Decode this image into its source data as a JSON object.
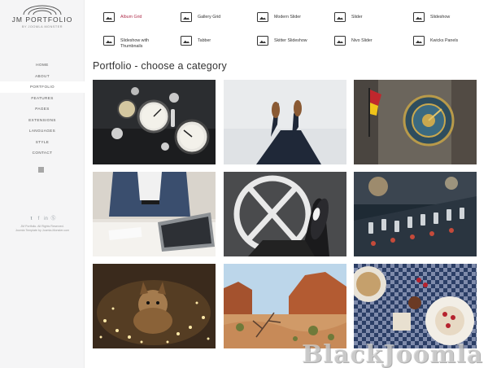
{
  "sidebar": {
    "logo_title": "JM PORTFOLIO",
    "logo_subtitle": "BY JOOMLA MONSTER",
    "menu": [
      "HOME",
      "ABOUT",
      "PORTFOLIO",
      "FEATURES",
      "PAGES",
      "EXTENSIONS",
      "LANGUAGES",
      "STYLE",
      "CONTACT"
    ],
    "active_item": "PORTFOLIO",
    "social_icons": [
      "twitter-icon",
      "facebook-icon",
      "linkedin-icon",
      "skype-icon"
    ],
    "copyright_line1": "JM Portfolio. All Rights Reserved.",
    "copyright_line2": "Joomla Template by Joomla-Monster.com"
  },
  "categories": [
    {
      "label": "Album Grid",
      "active": true,
      "icon": "album-grid-icon"
    },
    {
      "label": "Gallery Grid",
      "active": false,
      "icon": "gallery-grid-icon"
    },
    {
      "label": "Modern Slider",
      "active": false,
      "icon": "modern-slider-icon"
    },
    {
      "label": "Slider",
      "active": false,
      "icon": "slider-icon"
    },
    {
      "label": "Slideshow",
      "active": false,
      "icon": "slideshow-icon"
    },
    {
      "label": "Slideshow with Thumbnails",
      "active": false,
      "icon": "slideshow-thumbnails-icon"
    },
    {
      "label": "Tabber",
      "active": false,
      "icon": "tabber-icon"
    },
    {
      "label": "Skitter Slideshow",
      "active": false,
      "icon": "skitter-slideshow-icon"
    },
    {
      "label": "Nivo Slider",
      "active": false,
      "icon": "nivo-slider-icon"
    },
    {
      "label": "Kwicks Panels",
      "active": false,
      "icon": "kwicks-panels-icon"
    }
  ],
  "heading": "Portfolio - choose a category",
  "gallery": [
    "car-dashboard-gauges",
    "feet-on-snow",
    "astronomical-clock-tower",
    "man-with-laptop",
    "shoes-on-road-marking",
    "audio-mixer-console",
    "dog-with-fairy-lights",
    "red-rock-desert",
    "food-on-checkered-tablecloth"
  ],
  "colors": {
    "active_category": "#b0304e",
    "sidebar_bg": "#f5f5f6",
    "text": "#333333"
  },
  "watermark": "BlackJoomla"
}
